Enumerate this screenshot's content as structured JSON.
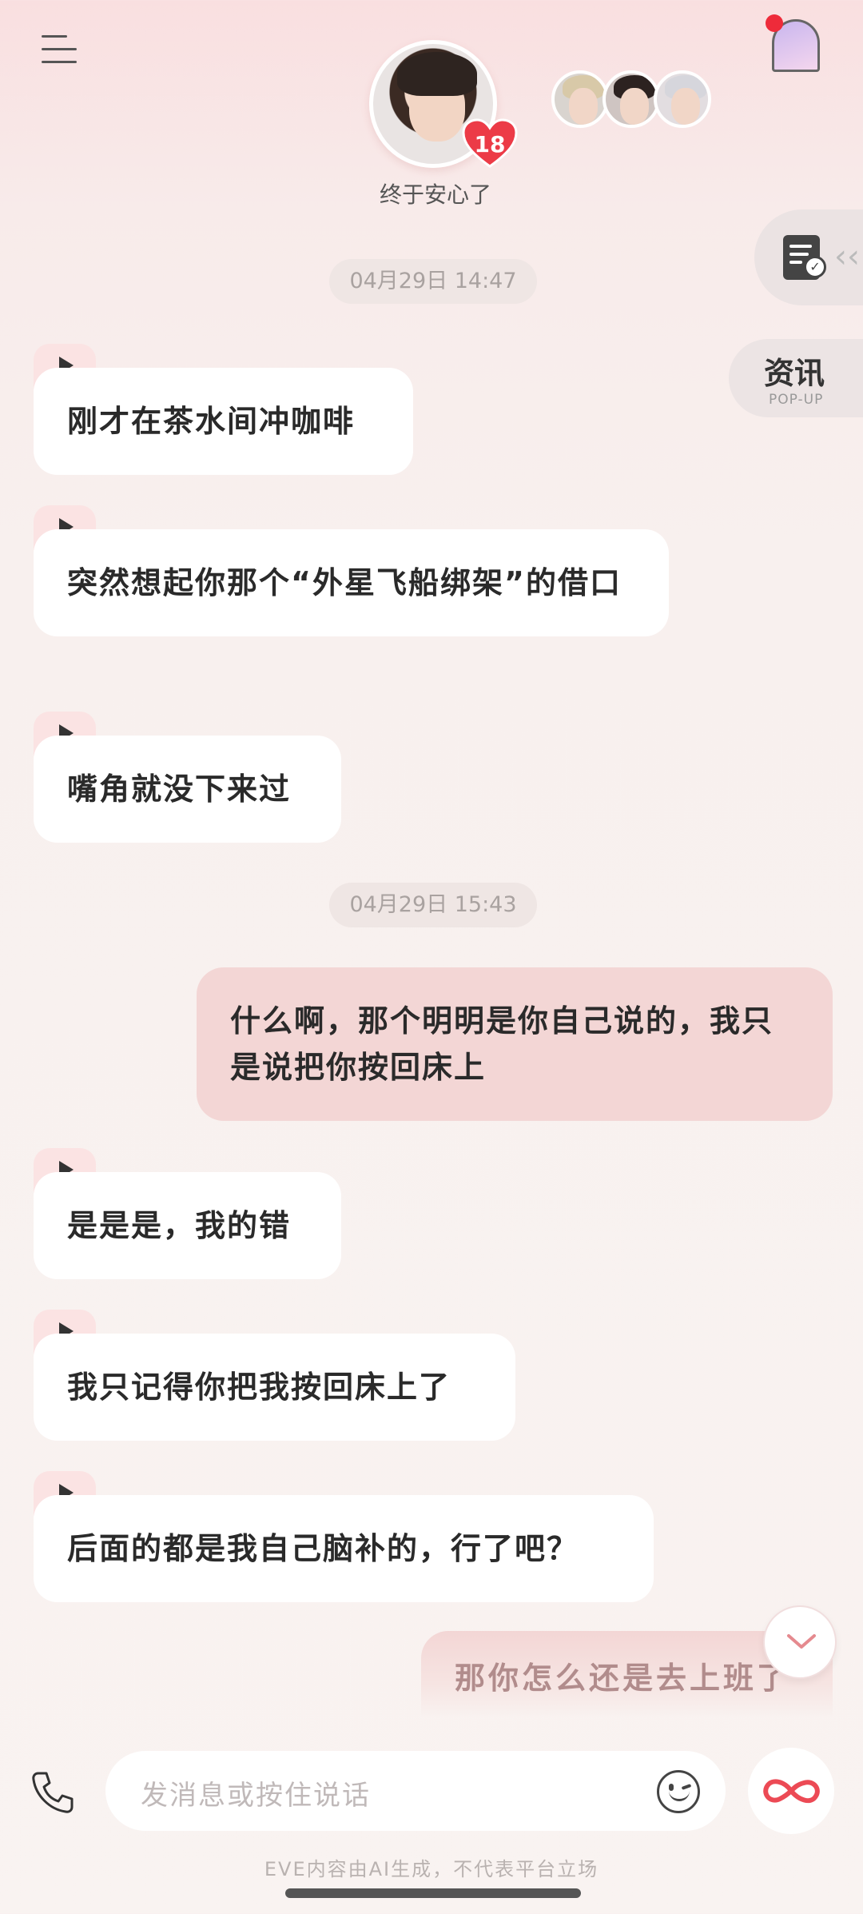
{
  "header": {
    "character_level": "18",
    "status_text": "终于安心了"
  },
  "side_buttons": {
    "news_label": "资讯",
    "news_sub": "POP-UP"
  },
  "messages": [
    {
      "type": "time",
      "text": "04月29日 14:47"
    },
    {
      "type": "received",
      "text": "刚才在茶水间冲咖啡"
    },
    {
      "type": "received",
      "text": "突然想起你那个“外星飞船绑架”的借口"
    },
    {
      "type": "received",
      "text": "嘴角就没下来过"
    },
    {
      "type": "time",
      "text": "04月29日 15:43"
    },
    {
      "type": "sent",
      "text": "什么啊，那个明明是你自己说的，我只是说把你按回床上"
    },
    {
      "type": "received",
      "text": "是是是，我的错"
    },
    {
      "type": "received",
      "text": "我只记得你把我按回床上了"
    },
    {
      "type": "received",
      "text": "后面的都是我自己脑补的，行了吧？"
    },
    {
      "type": "sent_partial",
      "text": "那你怎么还是去上班了"
    }
  ],
  "input": {
    "placeholder": "发消息或按住说话"
  },
  "footer": {
    "disclaimer": "EVE内容由AI生成，不代表平台立场"
  },
  "colors": {
    "accent_red": "#ee2b3a",
    "sent_bubble": "#f3d6d5",
    "received_bubble": "#ffffff",
    "play_tab": "#fbe3e3"
  },
  "icons": [
    "menu-icon",
    "heart-icon",
    "scene-icon",
    "task-icon",
    "play-icon",
    "chevron-down-icon",
    "phone-icon",
    "emoji-icon",
    "infinity-icon"
  ]
}
